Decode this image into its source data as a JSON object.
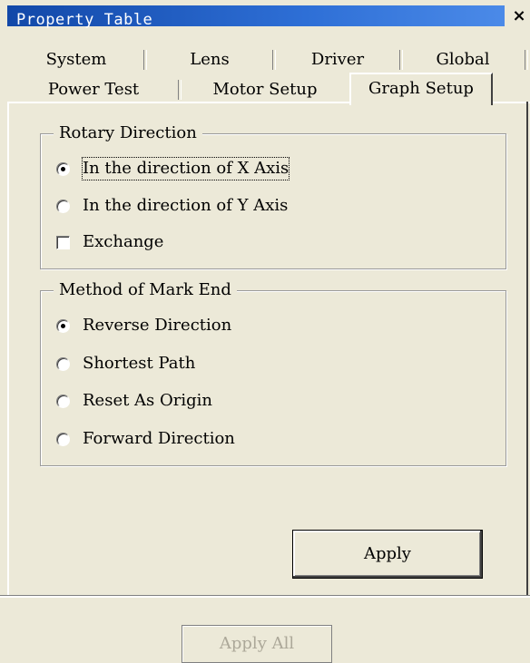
{
  "window": {
    "title": "Property Table",
    "close_label": "×"
  },
  "tabs": {
    "row1": [
      "System",
      "Lens",
      "Driver",
      "Global"
    ],
    "row2": [
      "Power Test",
      "Motor Setup"
    ],
    "active": "Graph Setup"
  },
  "rotary_direction": {
    "legend": "Rotary Direction",
    "options": [
      "In the direction of X Axis",
      "In the direction of Y Axis"
    ],
    "selected": "In the direction of X Axis",
    "exchange_label": "Exchange",
    "exchange_checked": false
  },
  "mark_end": {
    "legend": "Method of Mark End",
    "options": [
      "Reverse Direction",
      "Shortest Path",
      "Reset As Origin",
      "Forward Direction"
    ],
    "selected": "Reverse Direction"
  },
  "buttons": {
    "apply": "Apply",
    "apply_all": "Apply All"
  }
}
